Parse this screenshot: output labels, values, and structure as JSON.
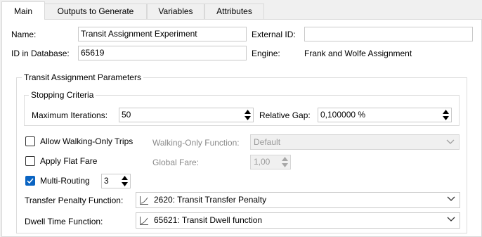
{
  "tabs": [
    "Main",
    "Outputs to Generate",
    "Variables",
    "Attributes"
  ],
  "name_label": "Name:",
  "name_value": "Transit Assignment Experiment",
  "external_id_label": "External ID:",
  "external_id_value": "",
  "db_id_label": "ID in Database:",
  "db_id_value": "65619",
  "engine_label": "Engine:",
  "engine_value": "Frank and Wolfe Assignment",
  "params_title": "Transit Assignment Parameters",
  "stopping_title": "Stopping Criteria",
  "max_iter_label": "Maximum Iterations:",
  "max_iter_value": "50",
  "rel_gap_label": "Relative Gap:",
  "rel_gap_value": "0,100000 %",
  "walking_only_label": "Allow Walking-Only Trips",
  "walking_only_checked": false,
  "walking_fn_label": "Walking-Only Function:",
  "walking_fn_value": "Default",
  "flat_fare_label": "Apply Flat Fare",
  "flat_fare_checked": false,
  "global_fare_label": "Global Fare:",
  "global_fare_value": "1,00",
  "multi_routing_label": "Multi-Routing",
  "multi_routing_checked": true,
  "multi_routing_value": "3",
  "transfer_label": "Transfer Penalty Function:",
  "transfer_value": "2620: Transit Transfer Penalty",
  "dwell_label": "Dwell Time Function:",
  "dwell_value": "65621: Transit Dwell function",
  "colors": {
    "accent": "#0a64c2",
    "border": "#d9d9d9",
    "panel": "#ffffff",
    "window": "#f0f0f0"
  }
}
